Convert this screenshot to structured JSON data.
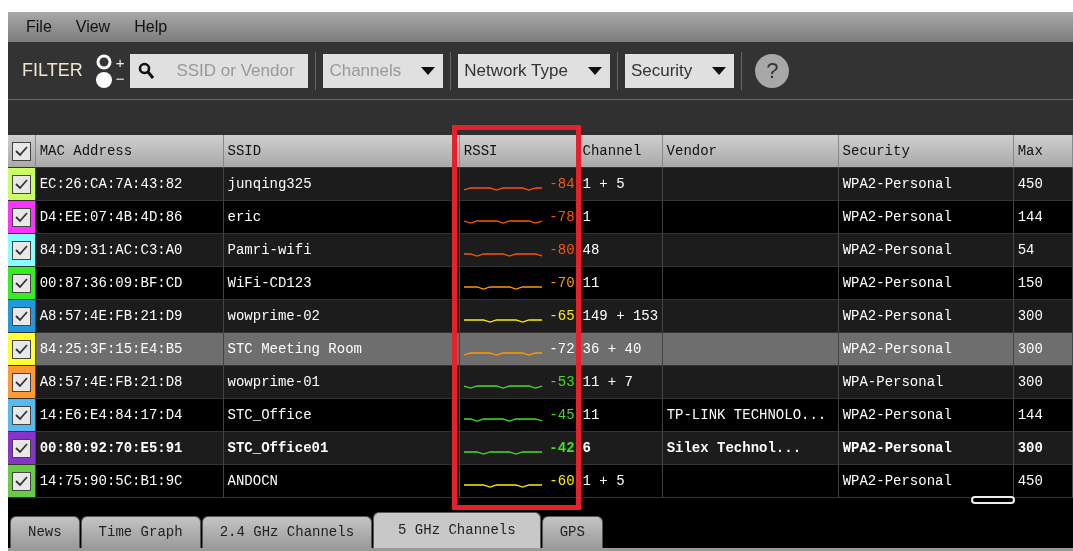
{
  "menu": [
    "File",
    "View",
    "Help"
  ],
  "filter": {
    "label": "FILTER",
    "plus": "+",
    "minus": "−",
    "search": {
      "placeholder": "SSID or Vendor"
    },
    "dropdowns": [
      {
        "label": "Channels",
        "disabled": true
      },
      {
        "label": "Network Type",
        "disabled": false
      },
      {
        "label": "Security",
        "disabled": false
      }
    ],
    "help": "?"
  },
  "table": {
    "all_checked": true,
    "columns": [
      {
        "label": "MAC Address",
        "highlighted": false
      },
      {
        "label": "SSID",
        "highlighted": false
      },
      {
        "label": "RSSI",
        "highlighted": true
      },
      {
        "label": "Channel",
        "highlighted": false
      },
      {
        "label": "Vendor",
        "highlighted": false
      },
      {
        "label": "Security",
        "highlighted": false
      },
      {
        "label": "Max",
        "highlighted": false
      }
    ],
    "rows": [
      {
        "checked": true,
        "color": "#ccff66",
        "selected": false,
        "connected": false,
        "mac": "EC:26:CA:7A:43:82",
        "ssid": "junqing325",
        "rssi": "-84",
        "channel": "1 + 5",
        "vendor": "",
        "security": "WPA2-Personal",
        "max_rate": "450"
      },
      {
        "checked": true,
        "color": "#ff33ff",
        "selected": false,
        "connected": false,
        "mac": "D4:EE:07:4B:4D:86",
        "ssid": "eric",
        "rssi": "-78",
        "channel": "1",
        "vendor": "",
        "security": "WPA2-Personal",
        "max_rate": "144"
      },
      {
        "checked": true,
        "color": "#88ffff",
        "selected": false,
        "connected": false,
        "mac": "84:D9:31:AC:C3:A0",
        "ssid": "Pamri-wifi",
        "rssi": "-80",
        "channel": "48",
        "vendor": "",
        "security": "WPA2-Personal",
        "max_rate": "54"
      },
      {
        "checked": true,
        "color": "#33ee22",
        "selected": false,
        "connected": false,
        "mac": "00:87:36:09:BF:CD",
        "ssid": "WiFi-CD123",
        "rssi": "-70",
        "channel": "11",
        "vendor": "",
        "security": "WPA2-Personal",
        "max_rate": "150"
      },
      {
        "checked": true,
        "color": "#2299dd",
        "selected": false,
        "connected": false,
        "mac": "A8:57:4E:FB:21:D9",
        "ssid": "wowprime-02",
        "rssi": "-65",
        "channel": "149 + 153",
        "vendor": "",
        "security": "WPA2-Personal",
        "max_rate": "300"
      },
      {
        "checked": true,
        "color": "#ffff33",
        "selected": true,
        "connected": false,
        "mac": "84:25:3F:15:E4:B5",
        "ssid": "STC Meeting Room",
        "rssi": "-72",
        "channel": "36 + 40",
        "vendor": "",
        "security": "WPA2-Personal",
        "max_rate": "300"
      },
      {
        "checked": true,
        "color": "#ff9933",
        "selected": false,
        "connected": false,
        "mac": "A8:57:4E:FB:21:D8",
        "ssid": "wowprime-01",
        "rssi": "-53",
        "channel": "11 + 7",
        "vendor": "",
        "security": "WPA-Personal",
        "max_rate": "300"
      },
      {
        "checked": true,
        "color": "#55bbee",
        "selected": false,
        "connected": false,
        "mac": "14:E6:E4:84:17:D4",
        "ssid": "STC_Office",
        "rssi": "-45",
        "channel": "11",
        "vendor": "TP-LINK TECHNOLO...",
        "security": "WPA2-Personal",
        "max_rate": "144"
      },
      {
        "checked": true,
        "color": "#8833cc",
        "selected": false,
        "connected": true,
        "mac": "00:80:92:70:E5:91",
        "ssid": "STC_Office01",
        "rssi": "-42",
        "channel": "6",
        "vendor": "Silex Technol...",
        "security": "WPA2-Personal",
        "max_rate": "300"
      },
      {
        "checked": true,
        "color": "#66cc44",
        "selected": false,
        "connected": false,
        "mac": "14:75:90:5C:B1:9C",
        "ssid": "ANDOCN",
        "rssi": "-60",
        "channel": "1 + 5",
        "vendor": "",
        "security": "WPA2-Personal",
        "max_rate": "450"
      }
    ]
  },
  "tabs": [
    {
      "label": "News",
      "selected": false
    },
    {
      "label": "Time Graph",
      "selected": false
    },
    {
      "label": "2.4 GHz Channels",
      "selected": false
    },
    {
      "label": "5 GHz Channels",
      "selected": true
    },
    {
      "label": "GPS",
      "selected": false
    }
  ]
}
